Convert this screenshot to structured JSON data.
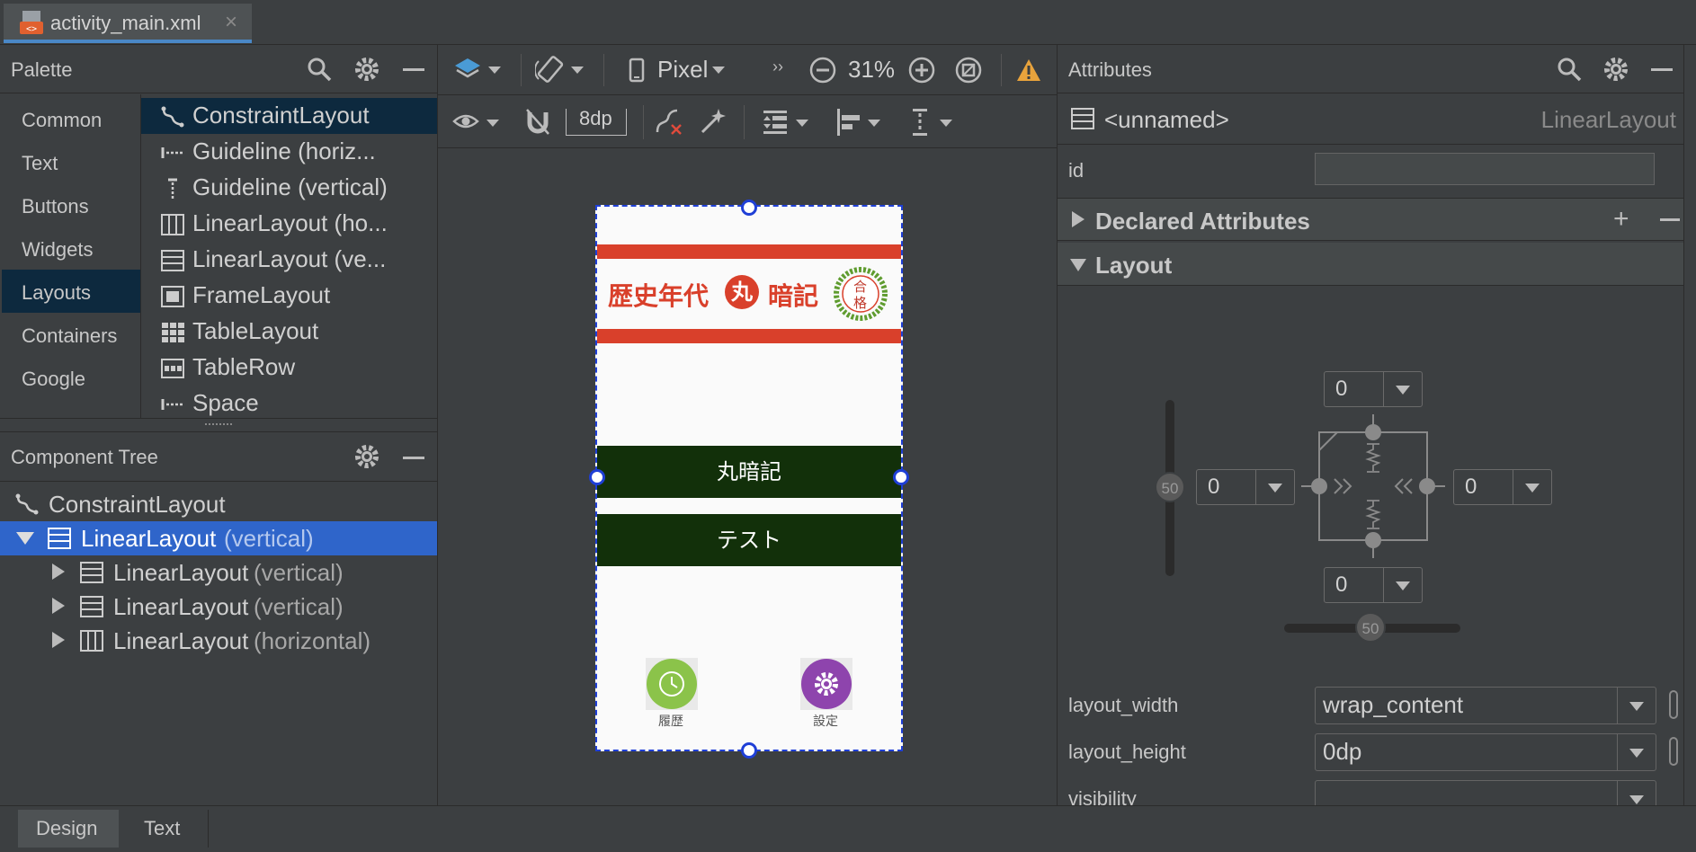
{
  "editor_tab": {
    "filename": "activity_main.xml",
    "close": "×"
  },
  "palette": {
    "title": "Palette",
    "categories": [
      "Common",
      "Text",
      "Buttons",
      "Widgets",
      "Layouts",
      "Containers",
      "Google"
    ],
    "selected_category": "Layouts",
    "items": [
      {
        "label": "ConstraintLayout",
        "icon": "constraint-layout-icon"
      },
      {
        "label": "Guideline (horiz...",
        "icon": "guideline-horizontal-icon"
      },
      {
        "label": "Guideline (vertical)",
        "icon": "guideline-vertical-icon"
      },
      {
        "label": "LinearLayout (ho...",
        "icon": "linear-layout-horizontal-icon"
      },
      {
        "label": "LinearLayout (ve...",
        "icon": "linear-layout-vertical-icon"
      },
      {
        "label": "FrameLayout",
        "icon": "frame-layout-icon"
      },
      {
        "label": "TableLayout",
        "icon": "table-layout-icon"
      },
      {
        "label": "TableRow",
        "icon": "table-row-icon"
      },
      {
        "label": "Space",
        "icon": "space-icon"
      }
    ]
  },
  "component_tree": {
    "title": "Component Tree",
    "root": "ConstraintLayout",
    "selected": {
      "name": "LinearLayout",
      "orientation": "(vertical)"
    },
    "children": [
      {
        "name": "LinearLayout",
        "orientation": "(vertical)"
      },
      {
        "name": "LinearLayout",
        "orientation": "(vertical)"
      },
      {
        "name": "LinearLayout",
        "orientation": "(horizontal)"
      }
    ]
  },
  "toolbar": {
    "device": "Pixel",
    "zoom": "31%",
    "margin": "8dp"
  },
  "device_preview": {
    "banner_text_1": "歴史年代",
    "banner_circle": "丸",
    "banner_text_2": "暗記",
    "seal_text_top": "合",
    "seal_text_bottom": "格",
    "button_1": "丸暗記",
    "button_2": "テスト",
    "icon_1_label": "履歴",
    "icon_2_label": "設定",
    "colors": {
      "banner_red": "#d9402b",
      "button_green": "#12300a",
      "history_green": "#8bc34a",
      "settings_purple": "#8e44ad"
    }
  },
  "attributes": {
    "title": "Attributes",
    "component_name": "<unnamed>",
    "component_type": "LinearLayout",
    "id_label": "id",
    "id_value": "",
    "declared_section": "Declared Attributes",
    "layout_section": "Layout",
    "margins": {
      "top": "0",
      "left": "0",
      "right": "0",
      "bottom": "0"
    },
    "bias_vertical": "50",
    "bias_horizontal": "50",
    "rows": [
      {
        "label": "layout_width",
        "value": "wrap_content"
      },
      {
        "label": "layout_height",
        "value": "0dp"
      },
      {
        "label": "visibility",
        "value": ""
      }
    ]
  },
  "bottom_tabs": {
    "design": "Design",
    "text": "Text",
    "selected": "Design"
  }
}
